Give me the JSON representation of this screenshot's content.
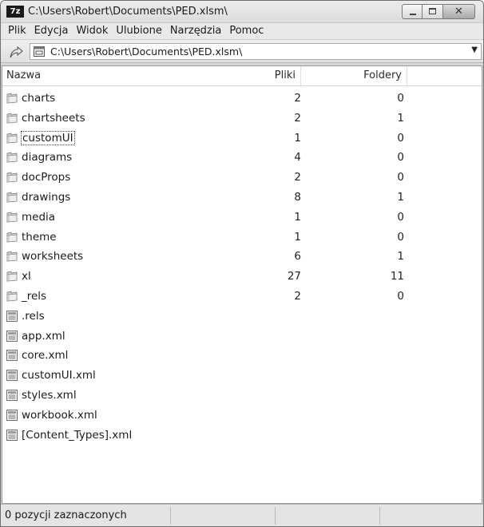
{
  "window": {
    "app_icon_text": "7z",
    "title": "C:\\Users\\Robert\\Documents\\PED.xlsm\\",
    "close_glyph": "✕"
  },
  "menu": [
    "Plik",
    "Edycja",
    "Widok",
    "Ulubione",
    "Narzędzia",
    "Pomoc"
  ],
  "address": {
    "path": "C:\\Users\\Robert\\Documents\\PED.xlsm\\",
    "dropdown_glyph": "▼"
  },
  "columns": {
    "name": "Nazwa",
    "files": "Pliki",
    "folders": "Foldery"
  },
  "items": [
    {
      "name": "charts",
      "type": "folder",
      "files": "2",
      "folders": "0"
    },
    {
      "name": "chartsheets",
      "type": "folder",
      "files": "2",
      "folders": "1"
    },
    {
      "name": "customUI",
      "type": "folder",
      "files": "1",
      "folders": "0",
      "focused": true
    },
    {
      "name": "diagrams",
      "type": "folder",
      "files": "4",
      "folders": "0"
    },
    {
      "name": "docProps",
      "type": "folder",
      "files": "2",
      "folders": "0"
    },
    {
      "name": "drawings",
      "type": "folder",
      "files": "8",
      "folders": "1"
    },
    {
      "name": "media",
      "type": "folder",
      "files": "1",
      "folders": "0"
    },
    {
      "name": "theme",
      "type": "folder",
      "files": "1",
      "folders": "0"
    },
    {
      "name": "worksheets",
      "type": "folder",
      "files": "6",
      "folders": "1"
    },
    {
      "name": "xl",
      "type": "folder",
      "files": "27",
      "folders": "11"
    },
    {
      "name": "_rels",
      "type": "folder",
      "files": "2",
      "folders": "0"
    },
    {
      "name": ".rels",
      "type": "file",
      "files": "",
      "folders": ""
    },
    {
      "name": "app.xml",
      "type": "file",
      "files": "",
      "folders": ""
    },
    {
      "name": "core.xml",
      "type": "file",
      "files": "",
      "folders": ""
    },
    {
      "name": "customUI.xml",
      "type": "file",
      "files": "",
      "folders": ""
    },
    {
      "name": "styles.xml",
      "type": "file",
      "files": "",
      "folders": ""
    },
    {
      "name": "workbook.xml",
      "type": "file",
      "files": "",
      "folders": ""
    },
    {
      "name": "[Content_Types].xml",
      "type": "file",
      "files": "",
      "folders": ""
    }
  ],
  "status": {
    "selection": "0 pozycji zaznaczonych"
  },
  "icons": {
    "folder": "folder-icon",
    "file": "xml-file-icon",
    "up": "up-arrow-icon",
    "address": "archive-icon"
  }
}
